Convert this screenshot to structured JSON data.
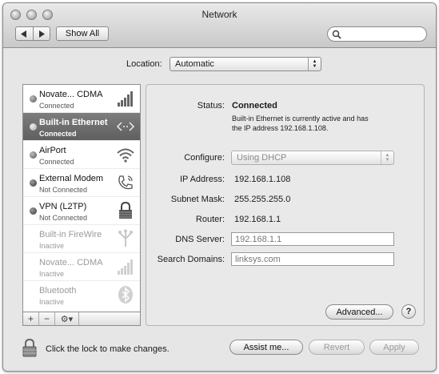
{
  "window": {
    "title": "Network"
  },
  "toolbar": {
    "back_icon": "back-arrow-icon",
    "forward_icon": "forward-arrow-icon",
    "show_all_label": "Show All",
    "search_placeholder": ""
  },
  "location": {
    "label": "Location:",
    "value": "Automatic"
  },
  "services": [
    {
      "name": "Novate... CDMA",
      "status": "Connected",
      "icon": "signal-bars-icon",
      "selected": false,
      "disabled": false
    },
    {
      "name": "Built-in Ethernet",
      "status": "Connected",
      "icon": "ethernet-arrows-icon",
      "selected": true,
      "disabled": false
    },
    {
      "name": "AirPort",
      "status": "Connected",
      "icon": "wifi-icon",
      "selected": false,
      "disabled": false
    },
    {
      "name": "External Modem",
      "status": "Not Connected",
      "icon": "phone-icon",
      "selected": false,
      "disabled": false
    },
    {
      "name": "VPN (L2TP)",
      "status": "Not Connected",
      "icon": "vpn-lock-icon",
      "selected": false,
      "disabled": false
    },
    {
      "name": "Built-in FireWire",
      "status": "Inactive",
      "icon": "firewire-icon",
      "selected": false,
      "disabled": true
    },
    {
      "name": "Novate... CDMA",
      "status": "Inactive",
      "icon": "signal-bars-icon",
      "selected": false,
      "disabled": true
    },
    {
      "name": "Bluetooth",
      "status": "Inactive",
      "icon": "bluetooth-icon",
      "selected": false,
      "disabled": true
    }
  ],
  "sidebar_buttons": {
    "add": "+",
    "remove": "−",
    "gear": "⚙▾"
  },
  "details": {
    "status_label": "Status:",
    "status_value": "Connected",
    "status_desc_1": "Built-in Ethernet is currently active and has",
    "status_desc_2": "the IP address 192.168.1.108.",
    "configure_label": "Configure:",
    "configure_value": "Using DHCP",
    "ip_label": "IP Address:",
    "ip_value": "192.168.1.108",
    "subnet_label": "Subnet Mask:",
    "subnet_value": "255.255.255.0",
    "router_label": "Router:",
    "router_value": "192.168.1.1",
    "dns_label": "DNS Server:",
    "dns_value": "192.168.1.1",
    "search_domains_label": "Search Domains:",
    "search_domains_value": "linksys.com",
    "advanced_label": "Advanced...",
    "help_label": "?"
  },
  "footer": {
    "lock_text": "Click the lock to make changes.",
    "assist_label": "Assist me...",
    "revert_label": "Revert",
    "apply_label": "Apply"
  }
}
